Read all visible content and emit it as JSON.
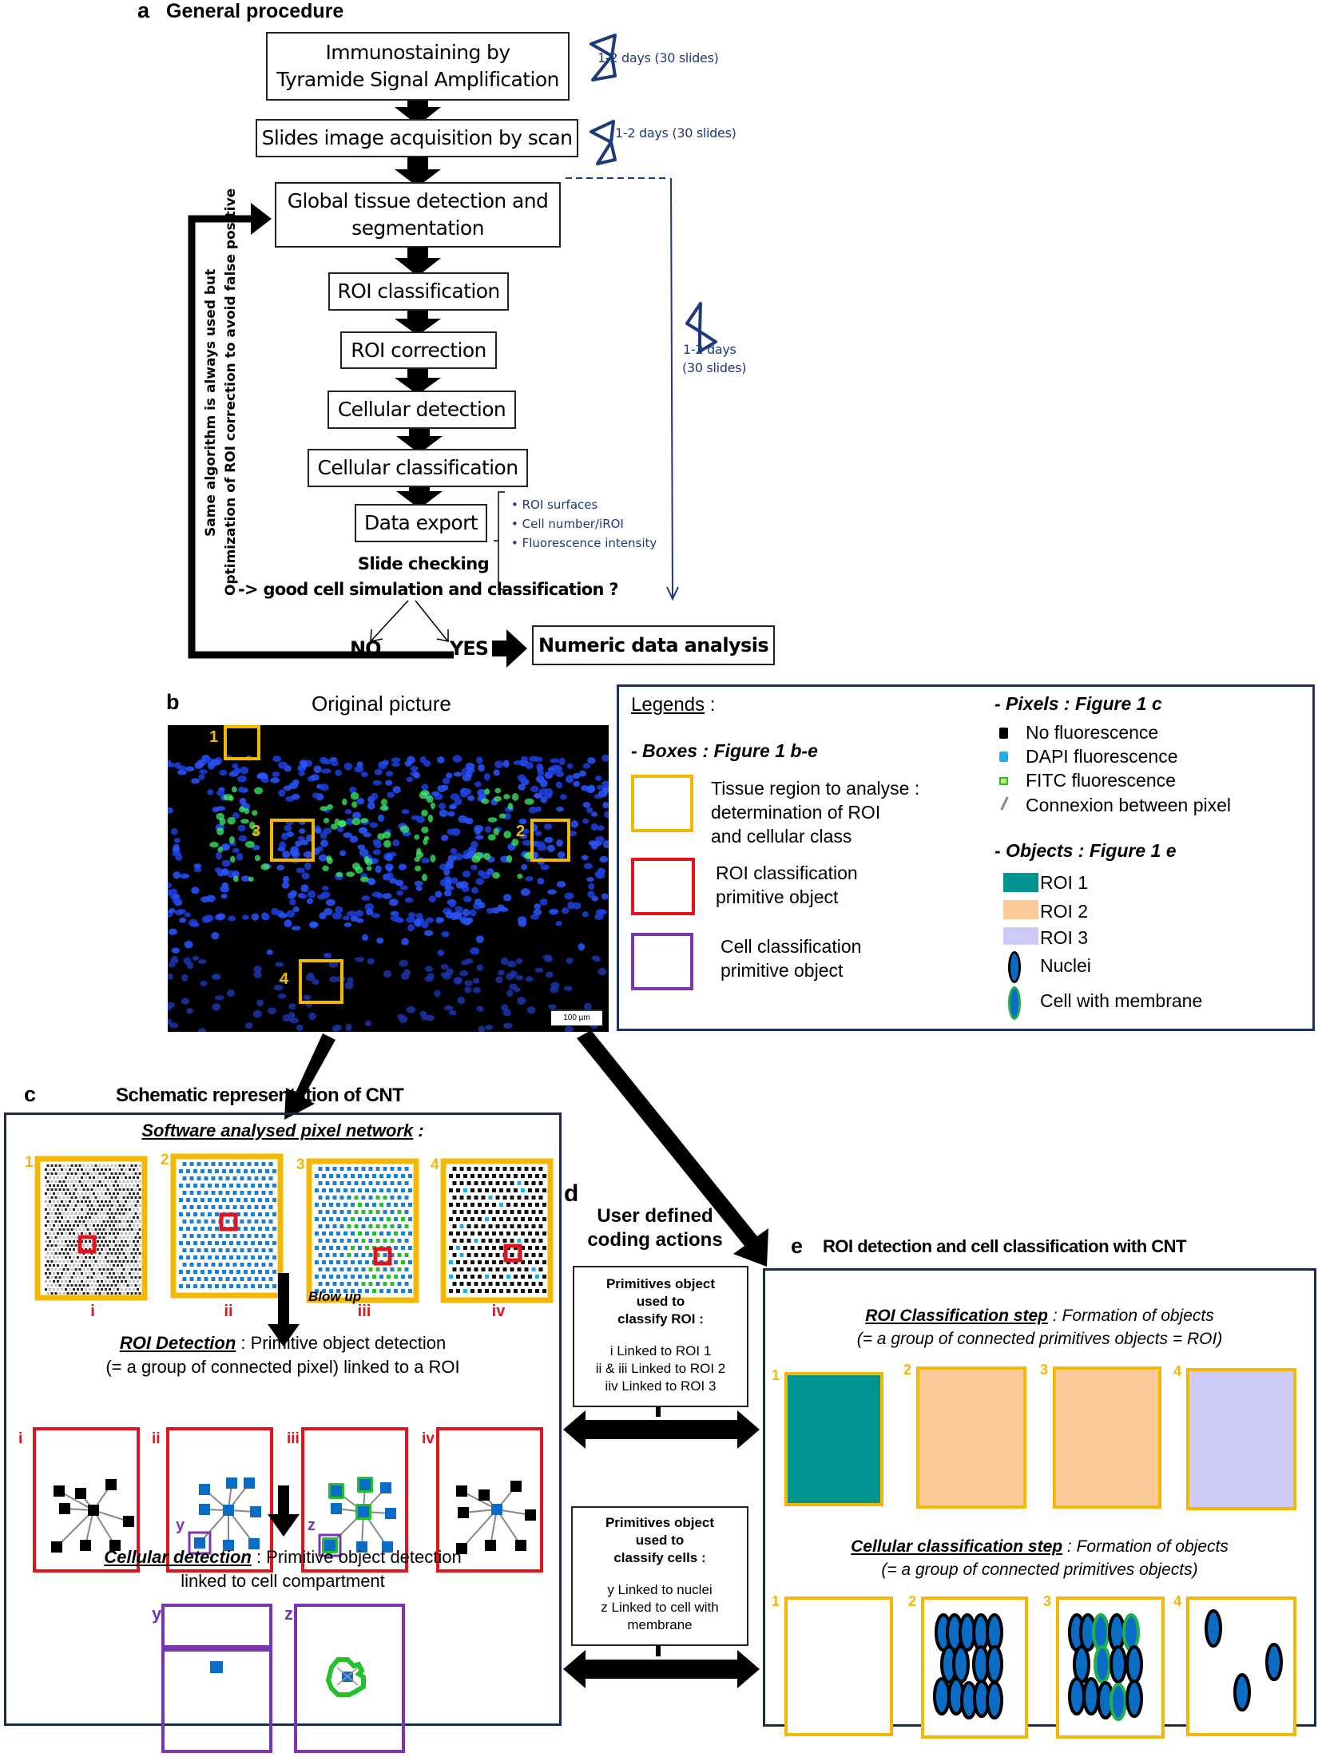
{
  "panel_a": {
    "letter": "a",
    "title": "General procedure",
    "steps": [
      {
        "line1": "Immunostaining by",
        "line2": "Tyramide Signal Amplification"
      },
      {
        "line1": "Slides image acquisition by scan"
      },
      {
        "line1": "Global tissue detection and",
        "line2": "segmentation"
      },
      {
        "line1": "ROI classification"
      },
      {
        "line1": "ROI correction"
      },
      {
        "line1": "Cellular detection"
      },
      {
        "line1": "Cellular classification"
      },
      {
        "line1": "Data export"
      }
    ],
    "durations": {
      "step1": "1-2 days (30 slides)",
      "step2": "1-2 days (30 slides)",
      "analysis_line1": "1-2 days",
      "analysis_line2": "(30 slides)"
    },
    "exports": [
      "ROI surfaces",
      "Cell number/iROI",
      "Fluorescence intensity"
    ],
    "check_line1": "Slide checking",
    "check_line2": "-> good cell simulation and classification ?",
    "no_label": "NO",
    "yes_label": "YES",
    "final_step": "Numeric data analysis",
    "loop_line1": "Same algorithm is always used but",
    "loop_line2": "Optimization of ROI correction to avoid false positive"
  },
  "panel_b": {
    "letter": "b",
    "title": "Original picture",
    "box_labels": [
      "1",
      "2",
      "3",
      "4"
    ],
    "scale_bar": "100 µm"
  },
  "legend": {
    "title": "Legends",
    "title_suffix": " :",
    "boxes_heading": "- Boxes  : Figure 1 b-e",
    "boxes": [
      {
        "color": "#f5b800",
        "line1": "Tissue region to analyse :",
        "line2": "determination of ROI",
        "line3": "and cellular class"
      },
      {
        "color": "#e0141c",
        "line1": "ROI classification",
        "line2": "primitive object"
      },
      {
        "color": "#7a35b0",
        "line1": "Cell classification",
        "line2": "primitive object"
      }
    ],
    "pixels_heading": "- Pixels : Figure 1 c",
    "pixels": [
      {
        "label": "No fluorescence",
        "color": "#000000"
      },
      {
        "label": "DAPI fluorescence",
        "color": "#1ab0ec"
      },
      {
        "label": "FITC fluorescence",
        "color": "#22c02a"
      },
      {
        "label": "Connexion between pixel",
        "color": "#888888"
      }
    ],
    "objects_heading": "- Objects : Figure 1 e",
    "objects": [
      {
        "label": "ROI 1",
        "color": "#009490"
      },
      {
        "label": "ROI 2",
        "color": "#fccb99"
      },
      {
        "label": "ROI 3",
        "color": "#cccbf8"
      },
      {
        "label": "Nuclei",
        "color": "#0a6cc4"
      },
      {
        "label": "Cell with membrane",
        "color": "#22b04a"
      }
    ]
  },
  "panel_c": {
    "letter": "c",
    "title": "Schematic representation of  CNT",
    "network_heading": "Software analysed pixel network",
    "network_suffix": " :",
    "region_numbers": [
      "1",
      "2",
      "3",
      "4"
    ],
    "roman": [
      "i",
      "ii",
      "iii",
      "iv"
    ],
    "blow_up": "Blow up",
    "roi_heading": "ROI Detection",
    "roi_text1": " : Primitive object detection",
    "roi_text2": "(= a group  of connected  pixel)  linked  to a ROI",
    "cell_markers": [
      "y",
      "z"
    ],
    "cell_heading": "Cellular detection",
    "cell_text1": " : Primitive object detection",
    "cell_text2": "linked  to cell  compartment"
  },
  "panel_d": {
    "letter": "d",
    "title_line1": "User defined",
    "title_line2": "coding actions",
    "roi_box": {
      "h1": "Primitives  object",
      "h2": "used to",
      "h3": "classify  ROI  :",
      "l1": "i Linked to ROI  1",
      "l2": "ii & iii Linked  to ROI  2",
      "l3": "iiv Linked to ROI  3"
    },
    "cell_box": {
      "h1": "Primitives  object",
      "h2": "used to",
      "h3": "classify  cells  :",
      "l1": "y Linked to nuclei",
      "l2": "z Linked to cell with",
      "l3": "membrane"
    }
  },
  "panel_e": {
    "letter": "e",
    "title": "ROI detection and cell classification with CNT",
    "roi_heading": "ROI Classification step",
    "roi_text1": " : Formation of objects",
    "roi_text2": "(= a group  of connected primitives objects = ROI)",
    "roi_fills": [
      "#009490",
      "#fccb99",
      "#fccb99",
      "#cccbf8"
    ],
    "cell_heading": "Cellular classification  step",
    "cell_text1": " : Formation of objects",
    "cell_text2": "(= a group  of connected  primitives objects)",
    "region_numbers": [
      "1",
      "2",
      "3",
      "4"
    ]
  },
  "colors": {
    "yellow": "#f5b800",
    "red": "#e0141c",
    "purple": "#7a35b0",
    "navy": "#1f3a7a",
    "dapi": "#1a7fd0",
    "fitc": "#22c02a"
  }
}
